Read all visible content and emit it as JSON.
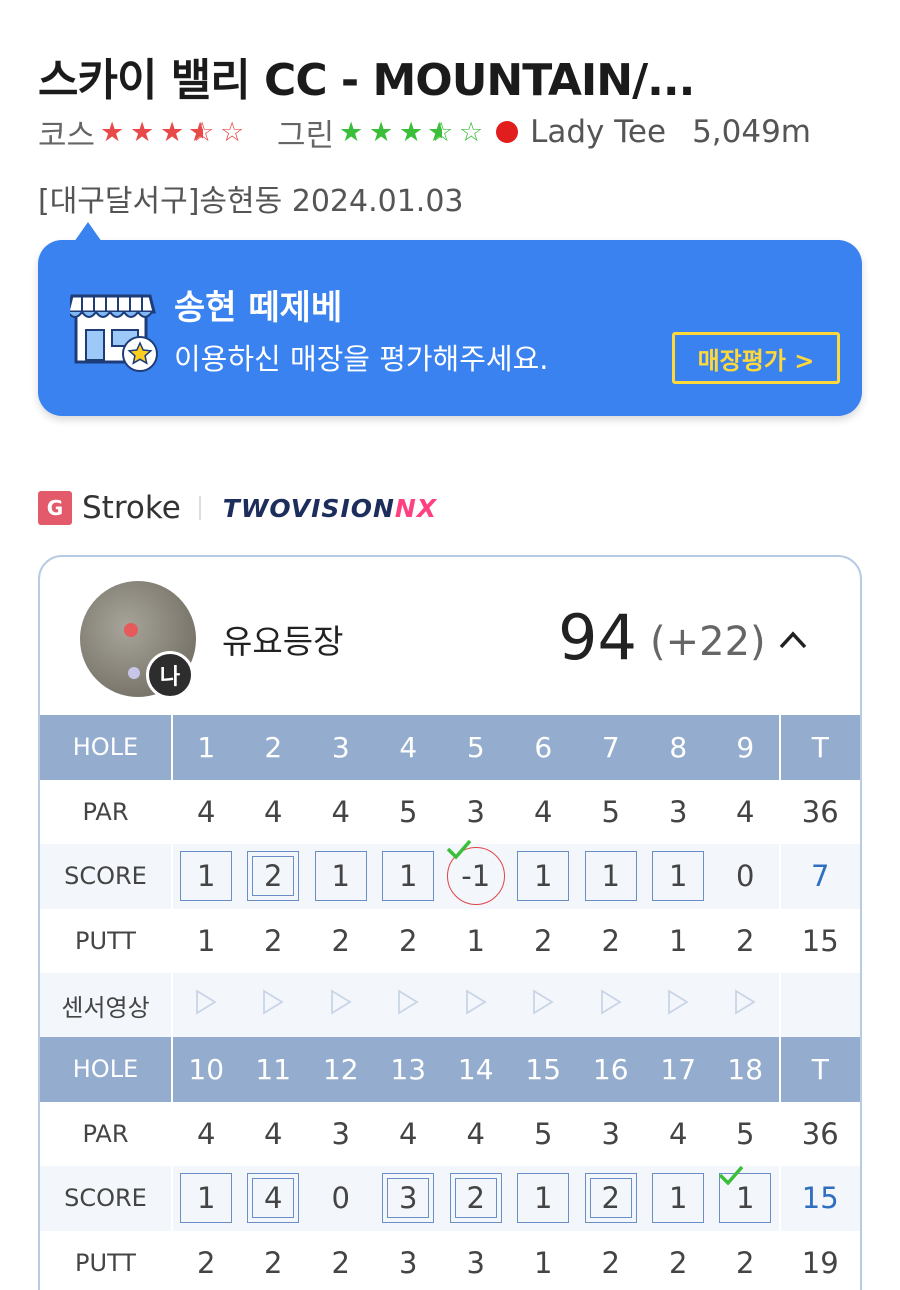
{
  "header": {
    "title": "스카이 밸리 CC - MOUNTAIN/...",
    "course_label": "코스",
    "course_rating": 3.5,
    "green_label": "그린",
    "green_rating": 3.5,
    "tee_label": "Lady Tee",
    "distance": "5,049m",
    "location_date": "[대구달서구]송현동 2024.01.03"
  },
  "banner": {
    "title": "송현 떼제베",
    "subtitle": "이용하신 매장을 평가해주세요.",
    "button_label": "매장평가 >"
  },
  "mode": {
    "badge": "G",
    "label": "Stroke",
    "logo_main": "TWOVISION",
    "logo_suffix": "NX"
  },
  "player": {
    "avatar_badge": "나",
    "name": "유요등장",
    "total": "94",
    "over_par": "(+22)"
  },
  "scorecard": {
    "row_labels": {
      "hole": "HOLE",
      "par": "PAR",
      "score": "SCORE",
      "putt": "PUTT",
      "sensor": "센서영상",
      "total": "T"
    },
    "front": {
      "holes": [
        "1",
        "2",
        "3",
        "4",
        "5",
        "6",
        "7",
        "8",
        "9"
      ],
      "par": [
        "4",
        "4",
        "4",
        "5",
        "3",
        "4",
        "5",
        "3",
        "4"
      ],
      "par_total": "36",
      "score": [
        "1",
        "2",
        "1",
        "1",
        "-1",
        "1",
        "1",
        "1",
        "0"
      ],
      "score_total": "7",
      "putt": [
        "1",
        "2",
        "2",
        "2",
        "1",
        "2",
        "2",
        "1",
        "2"
      ],
      "putt_total": "15"
    },
    "back": {
      "holes": [
        "10",
        "11",
        "12",
        "13",
        "14",
        "15",
        "16",
        "17",
        "18"
      ],
      "par": [
        "4",
        "4",
        "3",
        "4",
        "4",
        "5",
        "3",
        "4",
        "5"
      ],
      "par_total": "36",
      "score": [
        "1",
        "4",
        "0",
        "3",
        "2",
        "1",
        "2",
        "1",
        "1"
      ],
      "score_total": "15",
      "putt": [
        "2",
        "2",
        "2",
        "3",
        "3",
        "1",
        "2",
        "2",
        "2"
      ],
      "putt_total": "19"
    }
  }
}
